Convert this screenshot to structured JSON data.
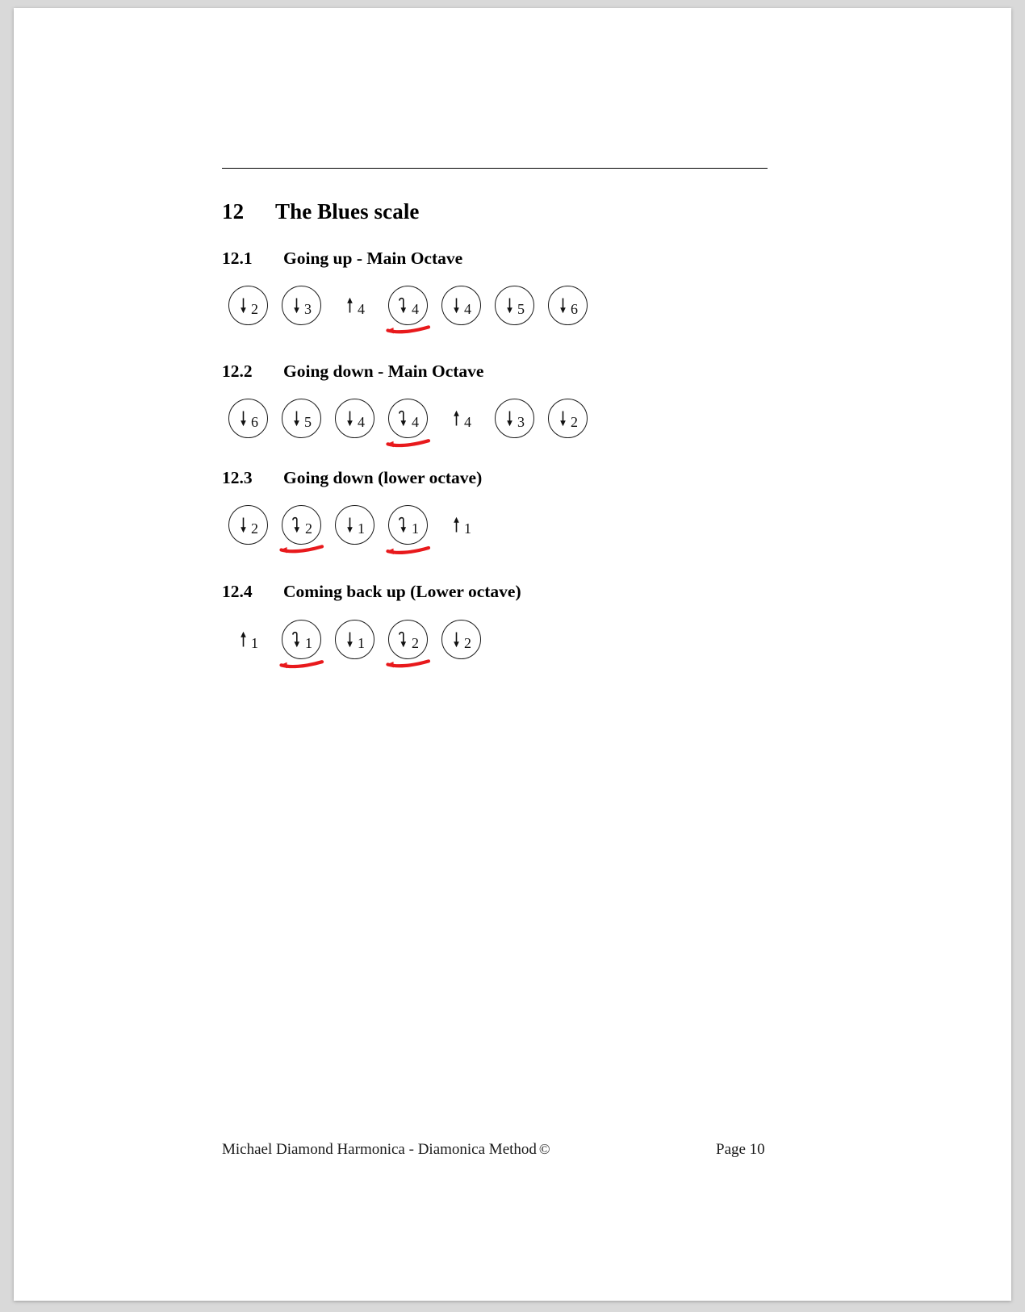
{
  "document": {
    "footer": {
      "credit": "Michael Diamond Harmonica - Diamonica Method",
      "copyright_symbol": "©",
      "page_label": "Page 10"
    }
  },
  "section": {
    "number": "12",
    "title": "The Blues scale"
  },
  "subsections": [
    {
      "number": "12.1",
      "title": "Going up - Main Octave",
      "notes": [
        {
          "direction": "down",
          "hole": "2",
          "circled": true,
          "bend": false,
          "annotated": false
        },
        {
          "direction": "down",
          "hole": "3",
          "circled": true,
          "bend": false,
          "annotated": false
        },
        {
          "direction": "up",
          "hole": "4",
          "circled": false,
          "bend": false,
          "annotated": false
        },
        {
          "direction": "down",
          "hole": "4",
          "circled": true,
          "bend": true,
          "annotated": true
        },
        {
          "direction": "down",
          "hole": "4",
          "circled": true,
          "bend": false,
          "annotated": false
        },
        {
          "direction": "down",
          "hole": "5",
          "circled": true,
          "bend": false,
          "annotated": false
        },
        {
          "direction": "down",
          "hole": "6",
          "circled": true,
          "bend": false,
          "annotated": false
        }
      ]
    },
    {
      "number": "12.2",
      "title": "Going down - Main Octave",
      "notes": [
        {
          "direction": "down",
          "hole": "6",
          "circled": true,
          "bend": false,
          "annotated": false
        },
        {
          "direction": "down",
          "hole": "5",
          "circled": true,
          "bend": false,
          "annotated": false
        },
        {
          "direction": "down",
          "hole": "4",
          "circled": true,
          "bend": false,
          "annotated": false
        },
        {
          "direction": "down",
          "hole": "4",
          "circled": true,
          "bend": true,
          "annotated": true
        },
        {
          "direction": "up",
          "hole": "4",
          "circled": false,
          "bend": false,
          "annotated": false
        },
        {
          "direction": "down",
          "hole": "3",
          "circled": true,
          "bend": false,
          "annotated": false
        },
        {
          "direction": "down",
          "hole": "2",
          "circled": true,
          "bend": false,
          "annotated": false
        }
      ]
    },
    {
      "number": "12.3",
      "title": "Going down (lower octave)",
      "notes": [
        {
          "direction": "down",
          "hole": "2",
          "circled": true,
          "bend": false,
          "annotated": false
        },
        {
          "direction": "down",
          "hole": "2",
          "circled": true,
          "bend": true,
          "annotated": true
        },
        {
          "direction": "down",
          "hole": "1",
          "circled": true,
          "bend": false,
          "annotated": false
        },
        {
          "direction": "down",
          "hole": "1",
          "circled": true,
          "bend": true,
          "annotated": true
        },
        {
          "direction": "up",
          "hole": "1",
          "circled": false,
          "bend": false,
          "annotated": false
        }
      ]
    },
    {
      "number": "12.4",
      "title": "Coming back up (Lower octave)",
      "notes": [
        {
          "direction": "up",
          "hole": "1",
          "circled": false,
          "bend": false,
          "annotated": false
        },
        {
          "direction": "down",
          "hole": "1",
          "circled": true,
          "bend": true,
          "annotated": true
        },
        {
          "direction": "down",
          "hole": "1",
          "circled": true,
          "bend": false,
          "annotated": false
        },
        {
          "direction": "down",
          "hole": "2",
          "circled": true,
          "bend": true,
          "annotated": true
        },
        {
          "direction": "down",
          "hole": "2",
          "circled": true,
          "bend": false,
          "annotated": false
        }
      ]
    }
  ],
  "layout": {
    "subsection_heading_tops": [
      298,
      438,
      570,
      711
    ],
    "note_row_tops": [
      338,
      478,
      610,
      752
    ]
  },
  "colors": {
    "ink": "#111111",
    "annotation_red": "#e8191c",
    "page_background": "#ffffff",
    "canvas_background": "#d9d9d9"
  }
}
